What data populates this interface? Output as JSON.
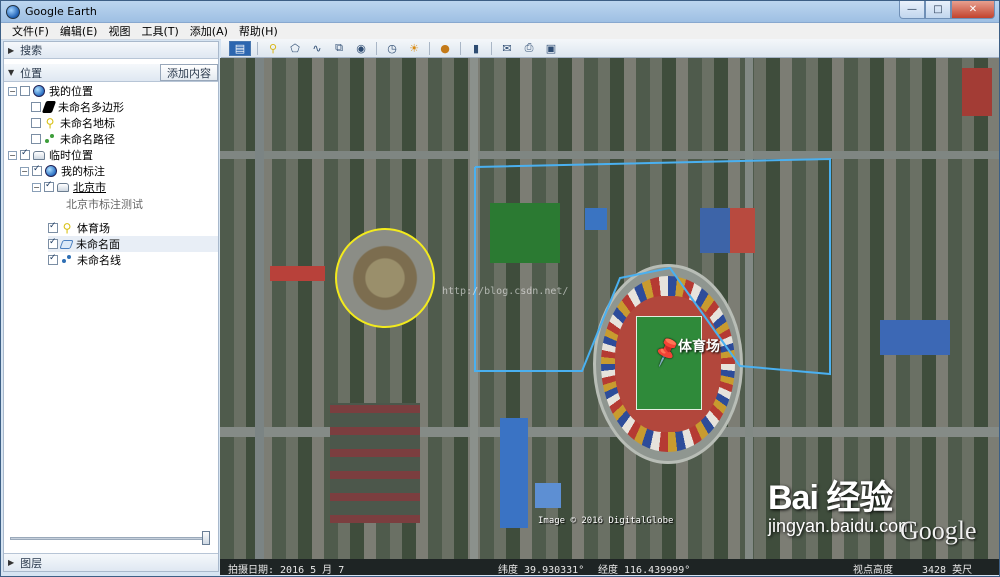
{
  "window": {
    "title": "Google Earth",
    "controls": {
      "minimize": "—",
      "maximize": "□",
      "close": "✕"
    }
  },
  "menu": [
    "文件(F)",
    "编辑(E)",
    "视图",
    "工具(T)",
    "添加(A)",
    "帮助(H)"
  ],
  "left_panel": {
    "search_label": "搜索",
    "places_label": "位置",
    "add_content_label": "添加内容",
    "layers_label": "图层",
    "tree": {
      "my_places": "我的位置",
      "untitled_polygon": "未命名多边形",
      "untitled_placemark": "未命名地标",
      "untitled_path": "未命名路径",
      "temporary_places": "临时位置",
      "my_annotations": "我的标注",
      "beijing": "北京市",
      "beijing_desc": "北京市标注测试",
      "gymnasium": "体育场",
      "untitled_surface": "未命名面",
      "untitled_line": "未命名线"
    }
  },
  "toolbar": {
    "icons": [
      "sidebar-icon",
      "placemark-icon",
      "polygon-icon",
      "path-icon",
      "image-overlay-icon",
      "record-tour-icon",
      "historical-imagery-icon",
      "sunlight-icon",
      "planets-icon",
      "ruler-icon",
      "email-icon",
      "print-icon",
      "save-image-icon"
    ]
  },
  "map": {
    "pin_label": "体育场",
    "copyright": "Image © 2016 DigitalGlobe",
    "google_logo": "Google",
    "watermark_brand": "Bai 经验",
    "watermark_url": "jingyan.baidu.com",
    "faint_url": "http://blog.csdn.net/"
  },
  "status": {
    "capture_date": "拍摄日期: 2016 5 月 7",
    "latitude": "纬度  39.930331°",
    "longitude": "经度  116.439999°",
    "elevation": "视点高度",
    "elevation_value": "3428 英尺"
  },
  "colors": {
    "polygon_outline": "#4ab0f0",
    "circle_outline": "#f2ea1d",
    "pin": "#f1d515"
  }
}
